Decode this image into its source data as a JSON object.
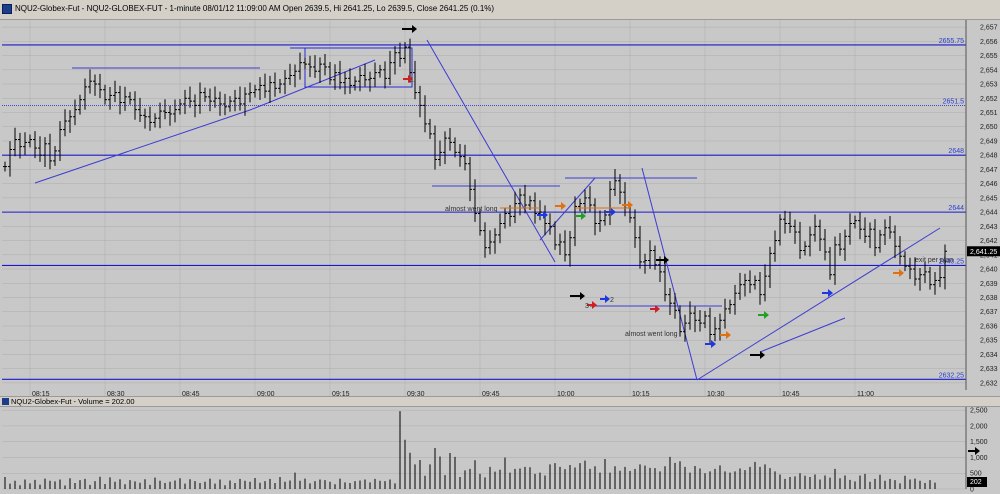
{
  "header": {
    "title": "NQU2-Globex-Fut - NQU2-GLOBEX-FUT - 1-minute 08/01/12 11:09:00 AM Open 2639.5, Hi 2641.25, Lo 2639.5, Close 2641.25 (0.1%)"
  },
  "volume_header": {
    "title": "NQU2-Globex-Fut - Volume = 202.00"
  },
  "colors": {
    "background": "#c8c8c8",
    "panel": "#d4d0c8",
    "bars": "#000000",
    "level_lines": "#1a1acc",
    "trend_lines": "#3c3cd2",
    "grid": "#a8a8a8"
  },
  "chart_data": [
    {
      "type": "ohlc",
      "title": "NQU2-Globex-Fut - NQU2-GLOBEX-FUT - 1-minute",
      "ylim": [
        2631.5,
        2657.5
      ],
      "yticks": [
        "2,657",
        "2,656",
        "2,655",
        "2,654",
        "2,653",
        "2,652",
        "2,651",
        "2,650",
        "2,649",
        "2,648",
        "2,647",
        "2,646",
        "2,645",
        "2,644",
        "2,643",
        "2,642",
        "2,641",
        "2,640",
        "2,639",
        "2,638",
        "2,637",
        "2,636",
        "2,635",
        "2,634",
        "2,633",
        "2,632"
      ],
      "xticks": [
        {
          "label": "08:15",
          "minute": 5
        },
        {
          "label": "08:30",
          "minute": 20
        },
        {
          "label": "08:45",
          "minute": 35
        },
        {
          "label": "09:00",
          "minute": 50
        },
        {
          "label": "09:15",
          "minute": 65
        },
        {
          "label": "09:30",
          "minute": 80
        },
        {
          "label": "09:45",
          "minute": 95
        },
        {
          "label": "10:00",
          "minute": 110
        },
        {
          "label": "10:15",
          "minute": 125
        },
        {
          "label": "10:30",
          "minute": 140
        },
        {
          "label": "10:45",
          "minute": 155
        },
        {
          "label": "11:00",
          "minute": 170
        }
      ],
      "first_bar_time": "08:10",
      "last_close_label": "2,641.25",
      "closes": [
        2647.2,
        2648.4,
        2649.1,
        2648.6,
        2648.9,
        2649.1,
        2648.5,
        2648.0,
        2648.8,
        2647.6,
        2648.3,
        2649.8,
        2650.4,
        2650.7,
        2651.2,
        2651.9,
        2652.8,
        2653.2,
        2653.0,
        2652.6,
        2651.9,
        2652.2,
        2652.4,
        2651.7,
        2652.1,
        2651.9,
        2651.2,
        2650.8,
        2650.7,
        2650.3,
        2650.6,
        2651.1,
        2651.0,
        2650.9,
        2651.2,
        2651.6,
        2652.0,
        2651.8,
        2651.5,
        2652.4,
        2652.1,
        2651.8,
        2652.0,
        2651.6,
        2651.4,
        2651.8,
        2652.0,
        2651.6,
        2652.3,
        2652.4,
        2652.6,
        2652.9,
        2652.5,
        2653.1,
        2652.7,
        2653.0,
        2653.4,
        2653.6,
        2653.9,
        2654.5,
        2654.4,
        2654.2,
        2653.9,
        2654.4,
        2654.2,
        2653.3,
        2653.8,
        2653.1,
        2653.4,
        2652.9,
        2653.2,
        2653.6,
        2653.3,
        2653.4,
        2653.8,
        2654.0,
        2653.4,
        2654.5,
        2655.2,
        2654.8,
        2655.6,
        2653.8,
        2652.4,
        2651.5,
        2650.2,
        2649.5,
        2647.7,
        2648.2,
        2649.2,
        2648.9,
        2648.2,
        2647.9,
        2647.4,
        2645.6,
        2643.9,
        2642.7,
        2641.5,
        2641.9,
        2642.4,
        2643.2,
        2643.9,
        2643.7,
        2644.6,
        2645.2,
        2644.5,
        2644.8,
        2643.9,
        2644.0,
        2643.2,
        2643.0,
        2641.7,
        2641.9,
        2641.0,
        2642.2,
        2644.4,
        2644.6,
        2645.0,
        2644.5,
        2643.2,
        2643.4,
        2643.8,
        2645.6,
        2646.2,
        2645.4,
        2644.3,
        2643.6,
        2642.2,
        2640.5,
        2640.6,
        2641.3,
        2640.3,
        2639.8,
        2638.2,
        2637.6,
        2637.1,
        2635.6,
        2636.2,
        2636.9,
        2636.4,
        2636.2,
        2636.7,
        2635.4,
        2635.8,
        2636.4,
        2637.2,
        2637.5,
        2638.3,
        2638.9,
        2639.2,
        2638.9,
        2639.2,
        2638.2,
        2639.5,
        2641.1,
        2642.0,
        2643.5,
        2643.2,
        2643.0,
        2642.6,
        2641.3,
        2641.6,
        2642.4,
        2643.0,
        2642.1,
        2641.2,
        2639.6,
        2641.7,
        2641.4,
        2642.3,
        2643.2,
        2643.4,
        2642.8,
        2642.3,
        2642.8,
        2641.5,
        2642.4,
        2642.9,
        2642.6,
        2641.6,
        2640.9,
        2640.2,
        2640.0,
        2639.3,
        2639.6,
        2639.8,
        2638.9,
        2639.2,
        2639.4,
        2641.25
      ],
      "volume": {
        "ylim": [
          0,
          2600
        ],
        "yticks": [
          "2,500",
          "2,000",
          "1,500",
          "1,000",
          "500",
          "0"
        ],
        "last_value_label": "202",
        "values": [
          380,
          170,
          260,
          120,
          300,
          180,
          290,
          140,
          330,
          260,
          240,
          300,
          110,
          340,
          190,
          280,
          320,
          130,
          250,
          390,
          160,
          370,
          230,
          310,
          150,
          280,
          240,
          200,
          310,
          130,
          360,
          260,
          190,
          230,
          270,
          340,
          170,
          310,
          250,
          190,
          230,
          330,
          170,
          300,
          120,
          270,
          190,
          320,
          260,
          230,
          350,
          200,
          250,
          320,
          190,
          380,
          230,
          270,
          520,
          260,
          330,
          180,
          250,
          300,
          280,
          230,
          150,
          330,
          210,
          190,
          250,
          270,
          300,
          210,
          320,
          260,
          250,
          300,
          180,
          2470,
          1560,
          1150,
          780,
          920,
          420,
          780,
          1300,
          1030,
          440,
          1140,
          1020,
          380,
          590,
          640,
          910,
          480,
          370,
          700,
          550,
          610,
          1000,
          520,
          640,
          650,
          700,
          690,
          480,
          520,
          430,
          780,
          820,
          700,
          630,
          760,
          680,
          820,
          900,
          640,
          720,
          520,
          950,
          520,
          720,
          580,
          700,
          570,
          640,
          780,
          740,
          670,
          660,
          560,
          720,
          1020,
          830,
          880,
          700,
          520,
          730,
          650,
          500,
          560,
          640,
          750,
          560,
          520,
          560,
          650,
          600,
          700,
          860,
          700,
          780,
          660,
          560,
          460,
          320,
          380,
          400,
          500,
          420,
          380,
          460,
          300,
          430,
          360,
          640,
          340,
          430,
          290,
          240,
          430,
          480,
          230,
          320,
          450,
          260,
          320,
          280,
          180,
          420,
          300,
          330,
          260,
          190,
          280,
          202
        ]
      }
    }
  ],
  "levels": [
    {
      "price": 2655.75,
      "label": "2655.75",
      "style": "solid"
    },
    {
      "price": 2651.5,
      "label": "2651.5",
      "style": "dotted"
    },
    {
      "price": 2648,
      "label": "2648",
      "style": "solid"
    },
    {
      "price": 2644,
      "label": "2644",
      "style": "solid"
    },
    {
      "price": 2640.25,
      "label": "2640.25",
      "style": "solid"
    },
    {
      "price": 2632.25,
      "label": "2632.25",
      "style": "solid"
    }
  ],
  "annotations": {
    "almost_long_1": "almost went long",
    "almost_long_2": "almost went long",
    "exit_per_plan": "exit per plan",
    "marker_1": "1",
    "marker_2": "2",
    "marker_3": "3",
    "marker_4": "2",
    "marker_5": "2"
  }
}
